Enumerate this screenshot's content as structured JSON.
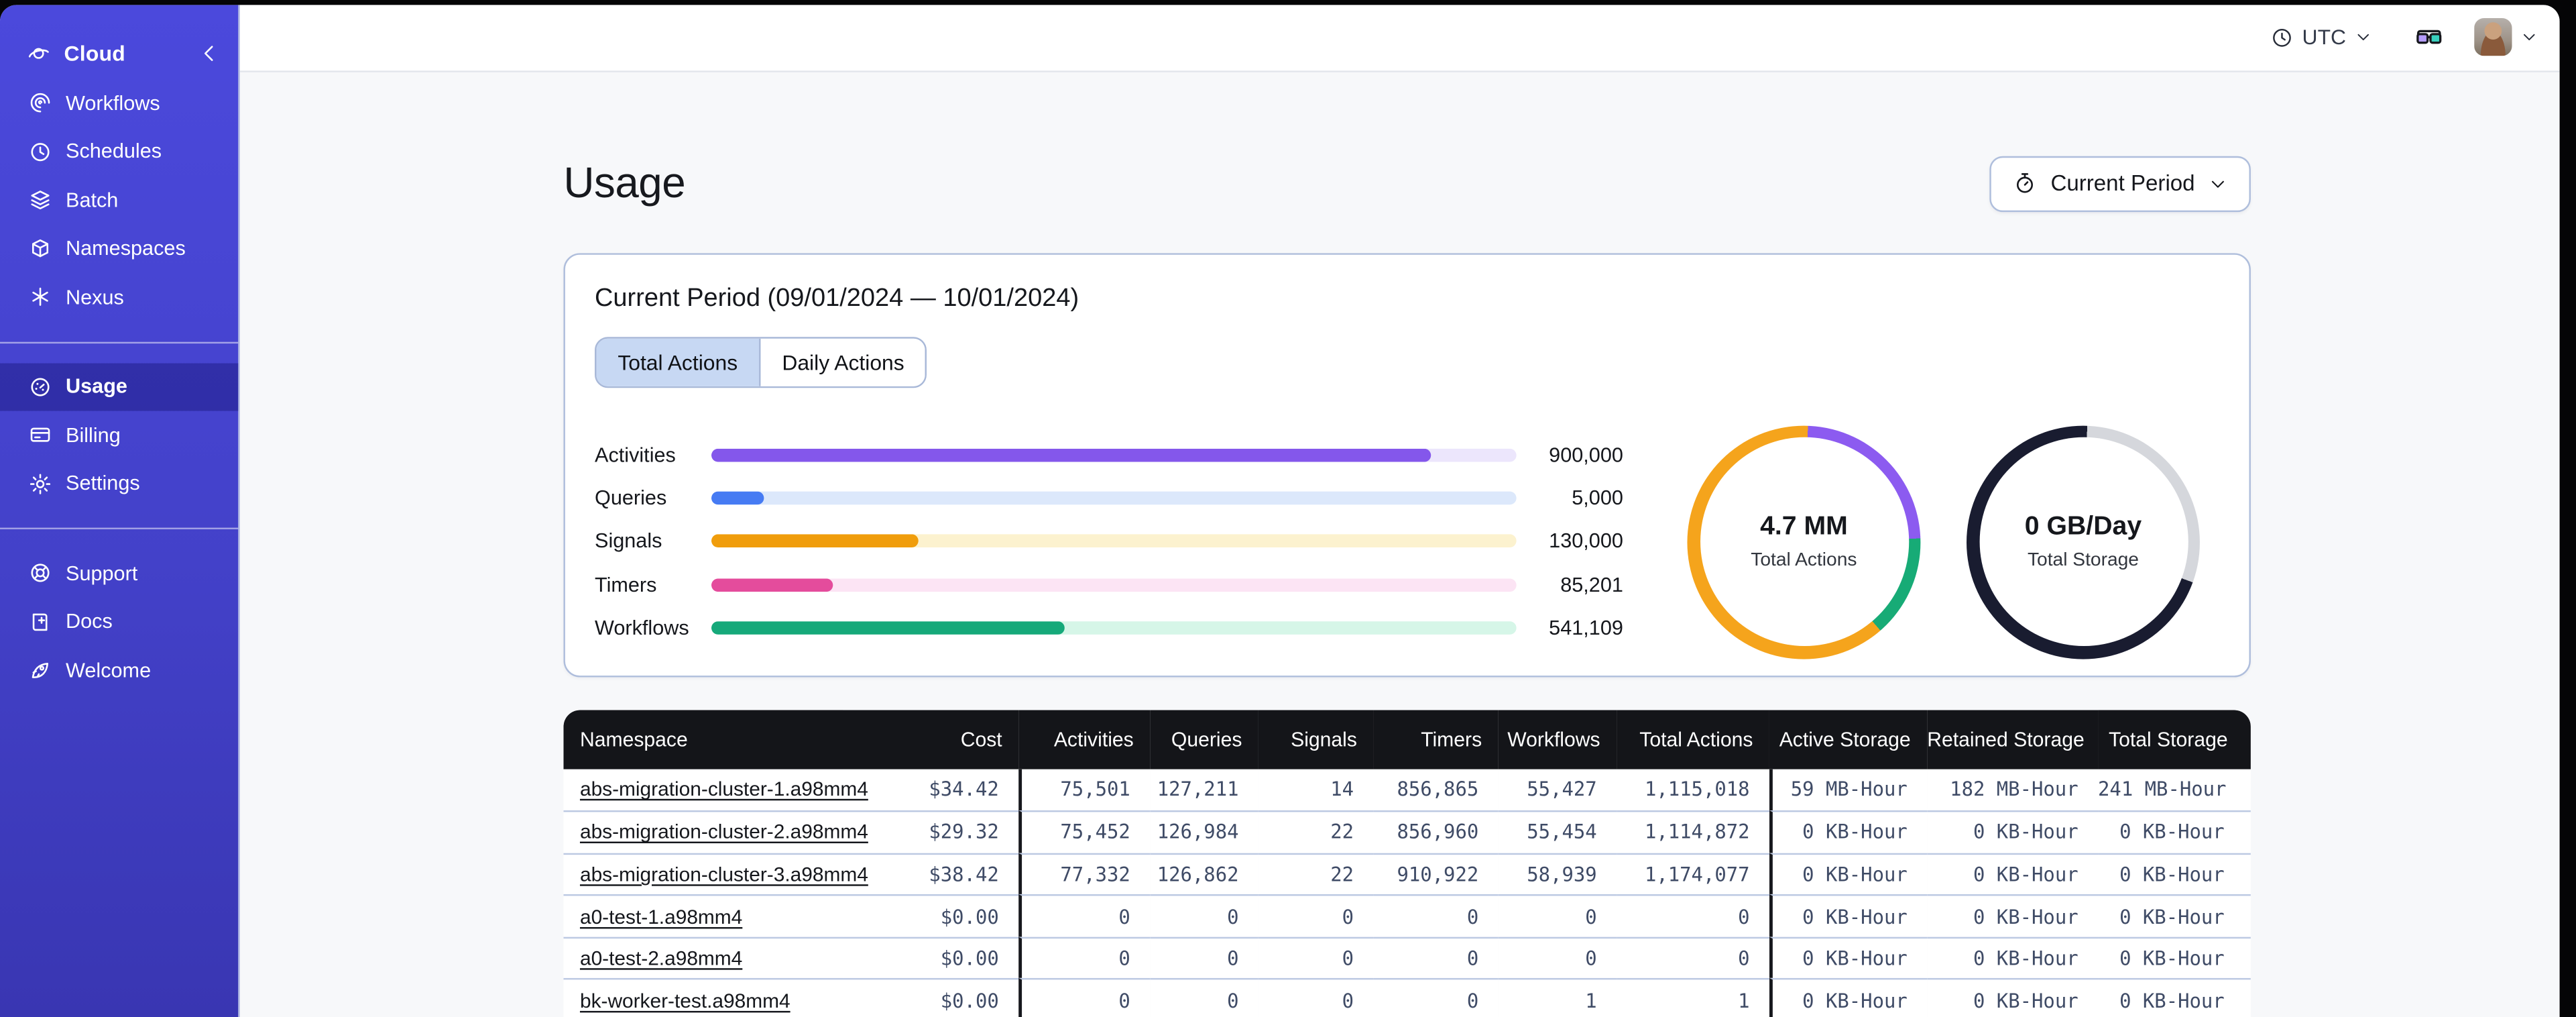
{
  "topbar": {
    "timezone": "UTC"
  },
  "sidebar": {
    "brand": {
      "label": "Cloud",
      "icon": "temporal-logo"
    },
    "groups": [
      {
        "items": [
          {
            "label": "Workflows",
            "icon": "workflows"
          },
          {
            "label": "Schedules",
            "icon": "schedules"
          },
          {
            "label": "Batch",
            "icon": "batch"
          },
          {
            "label": "Namespaces",
            "icon": "namespaces"
          },
          {
            "label": "Nexus",
            "icon": "nexus"
          }
        ]
      },
      {
        "items": [
          {
            "label": "Usage",
            "icon": "usage",
            "active": true
          },
          {
            "label": "Billing",
            "icon": "billing"
          },
          {
            "label": "Settings",
            "icon": "settings"
          }
        ]
      },
      {
        "items": [
          {
            "label": "Support",
            "icon": "support"
          },
          {
            "label": "Docs",
            "icon": "docs"
          },
          {
            "label": "Welcome",
            "icon": "welcome"
          }
        ]
      }
    ]
  },
  "page": {
    "title": "Usage",
    "period_button_label": "Current Period"
  },
  "usage_card": {
    "title": "Current Period (09/01/2024 — 10/01/2024)",
    "tabs": [
      {
        "label": "Total Actions",
        "selected": true
      },
      {
        "label": "Daily Actions",
        "selected": false
      }
    ]
  },
  "chart_data": [
    {
      "type": "bar",
      "orientation": "horizontal",
      "categories": [
        "Activities",
        "Queries",
        "Signals",
        "Timers",
        "Workflows"
      ],
      "values": [
        900000,
        5000,
        130000,
        85201,
        541109
      ],
      "value_labels": [
        "900,000",
        "5,000",
        "130,000",
        "85,201",
        "541,109"
      ],
      "fill_fractions": [
        0.893,
        0.065,
        0.258,
        0.152,
        0.439
      ],
      "bar_colors": [
        "#8457EB",
        "#467BF3",
        "#F09D0C",
        "#E44C9C",
        "#16A97A"
      ],
      "track_colors": [
        "#ECE6FC",
        "#DCE8FB",
        "#FCF2CF",
        "#FCE4F4",
        "#D6F6E8"
      ],
      "grid": false,
      "legend": false
    },
    {
      "type": "donut",
      "center_value": "4.7 MM",
      "center_label": "Total Actions",
      "segments": [
        {
          "label": "activities",
          "color": "#8C5BF0",
          "start_deg": 2,
          "end_deg": 88
        },
        {
          "label": "workflows",
          "color": "#17AB76",
          "start_deg": 88,
          "end_deg": 139
        },
        {
          "label": "signals",
          "color": "#F5A41C",
          "start_deg": 139,
          "end_deg": 360
        }
      ]
    },
    {
      "type": "donut",
      "center_value": "0 GB/Day",
      "center_label": "Total Storage",
      "segments": [
        {
          "label": "remaining",
          "color": "#D5D7DC",
          "start_deg": 2,
          "end_deg": 110
        },
        {
          "label": "used",
          "color": "#191C30",
          "start_deg": 110,
          "end_deg": 360
        }
      ]
    }
  ],
  "table": {
    "columns": [
      {
        "key": "namespace",
        "label": "Namespace",
        "width": 170
      },
      {
        "key": "cost",
        "label": "Cost",
        "width": 107
      },
      {
        "key": "activities",
        "label": "Activities",
        "width": 80,
        "group_start": true
      },
      {
        "key": "queries",
        "label": "Queries",
        "width": 66
      },
      {
        "key": "signals",
        "label": "Signals",
        "width": 70
      },
      {
        "key": "timers",
        "label": "Timers",
        "width": 76
      },
      {
        "key": "workflows",
        "label": "Workflows",
        "width": 72
      },
      {
        "key": "total_actions",
        "label": "Total Actions",
        "width": 93
      },
      {
        "key": "active_storage",
        "label": "Active Storage",
        "width": 96,
        "group_start": true
      },
      {
        "key": "retained_storage",
        "label": "Retained Storage",
        "width": 104
      },
      {
        "key": "total_storage",
        "label": "Total Storage",
        "width": 93
      }
    ],
    "rows": [
      [
        "abs-migration-cluster-1.a98mm4",
        "$34.42",
        "75,501",
        "127,211",
        "14",
        "856,865",
        "55,427",
        "1,115,018",
        "59 MB-Hour",
        "182 MB-Hour",
        "241 MB-Hour"
      ],
      [
        "abs-migration-cluster-2.a98mm4",
        "$29.32",
        "75,452",
        "126,984",
        "22",
        "856,960",
        "55,454",
        "1,114,872",
        "0 KB-Hour",
        "0 KB-Hour",
        "0 KB-Hour"
      ],
      [
        "abs-migration-cluster-3.a98mm4",
        "$38.42",
        "77,332",
        "126,862",
        "22",
        "910,922",
        "58,939",
        "1,174,077",
        "0 KB-Hour",
        "0 KB-Hour",
        "0 KB-Hour"
      ],
      [
        "a0-test-1.a98mm4",
        "$0.00",
        "0",
        "0",
        "0",
        "0",
        "0",
        "0",
        "0 KB-Hour",
        "0 KB-Hour",
        "0 KB-Hour"
      ],
      [
        "a0-test-2.a98mm4",
        "$0.00",
        "0",
        "0",
        "0",
        "0",
        "0",
        "0",
        "0 KB-Hour",
        "0 KB-Hour",
        "0 KB-Hour"
      ],
      [
        "bk-worker-test.a98mm4",
        "$0.00",
        "0",
        "0",
        "0",
        "0",
        "1",
        "1",
        "0 KB-Hour",
        "0 KB-Hour",
        "0 KB-Hour"
      ]
    ]
  }
}
